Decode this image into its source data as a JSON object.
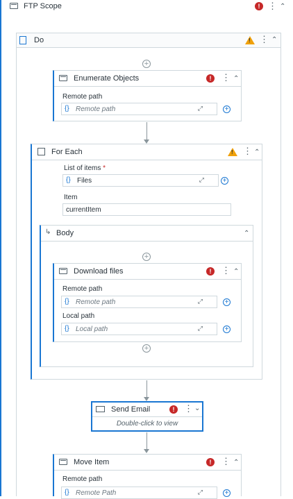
{
  "ftp_scope": {
    "title": "FTP Scope"
  },
  "do": {
    "title": "Do"
  },
  "enumerate": {
    "title": "Enumerate Objects",
    "remote_path_label": "Remote path",
    "remote_path_placeholder": "Remote path"
  },
  "for_each": {
    "title": "For Each",
    "list_label": "List of items",
    "required_mark": "*",
    "list_value": "Files",
    "item_label": "Item",
    "item_value": "currentItem"
  },
  "body": {
    "title": "Body"
  },
  "download": {
    "title": "Download files",
    "remote_path_label": "Remote path",
    "remote_path_placeholder": "Remote path",
    "local_path_label": "Local path",
    "local_path_placeholder": "Local path"
  },
  "send_email": {
    "title": "Send Email",
    "hint": "Double-click to view"
  },
  "move_item": {
    "title": "Move Item",
    "remote_path_label": "Remote path",
    "remote_path_placeholder": "Remote Path"
  },
  "icons": {
    "error": "!",
    "warning": "!",
    "kebab": "⋮",
    "collapse": "⌃",
    "expand": "⌄",
    "brace": "{}",
    "expand_editor": "⤢",
    "plus": "+"
  },
  "colors": {
    "accent": "#1976d2",
    "error": "#c62828",
    "warning": "#f0a10b"
  }
}
